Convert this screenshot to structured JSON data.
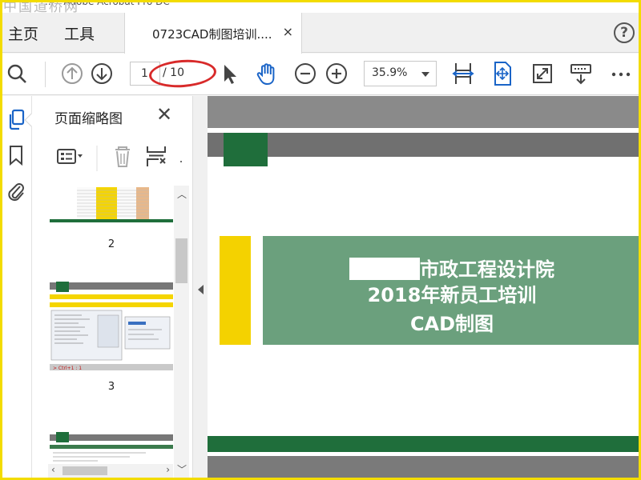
{
  "window": {
    "title": "... - Adobe Acrobat Pro DC",
    "min_button": "—"
  },
  "watermark": "中国道桥网",
  "menu": {
    "home": "主页",
    "tools": "工具"
  },
  "tab": {
    "title": "0723CAD制图培训....",
    "close": "×"
  },
  "help": "?",
  "toolbar": {
    "page_current": "1",
    "page_total": "/ 10",
    "zoom": "35.9%",
    "icons": [
      "search-icon",
      "page-up-icon",
      "page-down-icon",
      "select-arrow-icon",
      "hand-icon",
      "zoom-out-icon",
      "zoom-in-icon",
      "fit-width-icon",
      "fit-page-icon",
      "fullscreen-icon",
      "read-mode-icon",
      "more-icon"
    ]
  },
  "panel": {
    "title": "页面缩略图",
    "close": "✕",
    "thumbnails": [
      {
        "number": "2"
      },
      {
        "number": "3"
      }
    ]
  },
  "slide": {
    "line1_suffix": "市政工程设计院",
    "line2": "2018年新员工培训",
    "line3": "CAD制图"
  },
  "colors": {
    "green": "#1f6e3b",
    "light_green": "#6ba07d",
    "yellow": "#f4d200",
    "annotation_red": "#d82a2a"
  }
}
